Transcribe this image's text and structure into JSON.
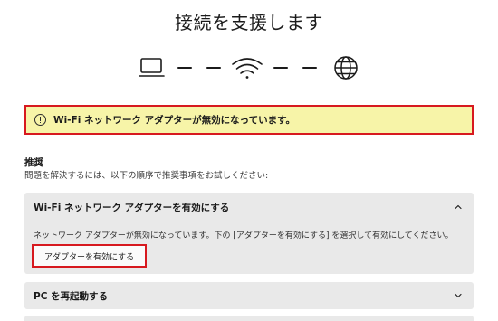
{
  "page": {
    "title": "接続を支援します"
  },
  "diagram": {
    "nodes": [
      "laptop-icon",
      "wifi-icon",
      "globe-icon"
    ]
  },
  "alert": {
    "icon": "warning-circle-icon",
    "message": "Wi-Fi ネットワーク アダプターが無効になっています。",
    "background": "#f7f4a8",
    "highlight_color": "#d7191f"
  },
  "recommendation": {
    "heading": "推奨",
    "description": "問題を解決するには、以下の順序で推奨事項をお試しください:"
  },
  "accordions": [
    {
      "title": "Wi-Fi ネットワーク アダプターを有効にする",
      "expanded": true,
      "body": "ネットワーク アダプターが無効になっています。下の [アダプターを有効にする] を選択して有効にしてください。",
      "button_label": "アダプターを有効にする"
    },
    {
      "title": "PC を再起動する",
      "expanded": false
    }
  ]
}
